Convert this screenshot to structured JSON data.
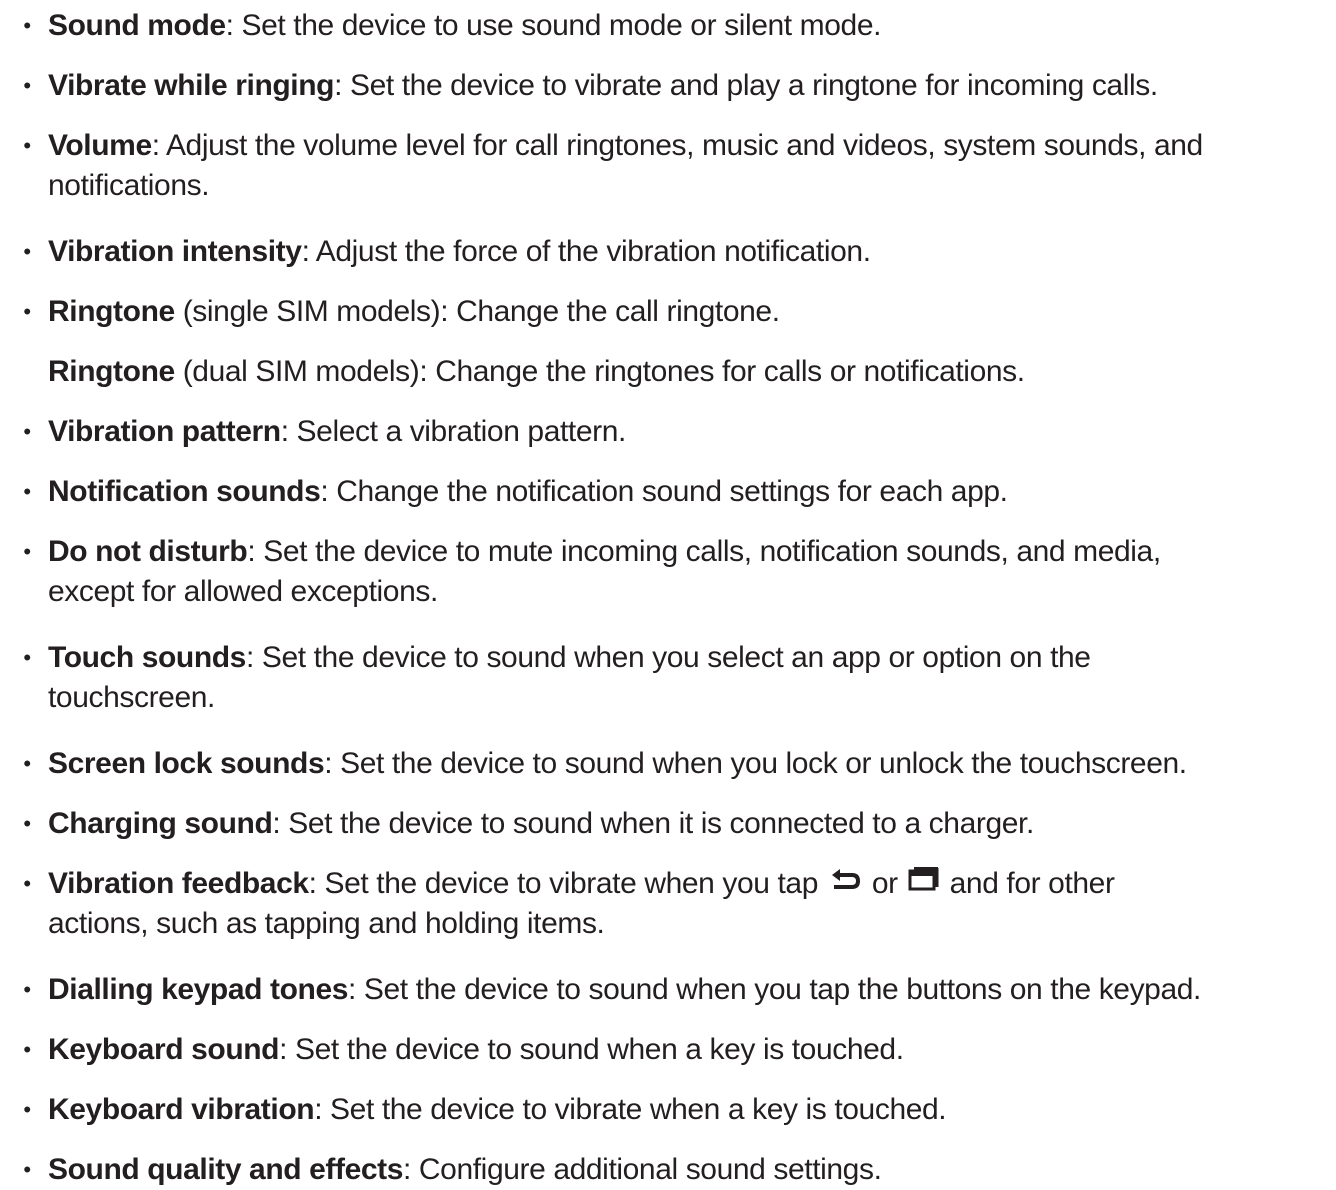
{
  "items": [
    {
      "term": "Sound mode",
      "desc": ": Set the device to use sound mode or silent mode."
    },
    {
      "term": "Vibrate while ringing",
      "desc": ": Set the device to vibrate and play a ringtone for incoming calls."
    },
    {
      "term": "Volume",
      "desc": ": Adjust the volume level for call ringtones, music and videos, system sounds, and",
      "cont": "notifications."
    },
    {
      "term": "Vibration intensity",
      "desc": ": Adjust the force of the vibration notification."
    },
    {
      "term": "Ringtone",
      "desc": " (single SIM models): Change the call ringtone.",
      "term2": "Ringtone",
      "desc2": " (dual SIM models): Change the ringtones for calls or notifications."
    },
    {
      "term": "Vibration pattern",
      "desc": ": Select a vibration pattern."
    },
    {
      "term": "Notification sounds",
      "desc": ": Change the notification sound settings for each app."
    },
    {
      "term": "Do not disturb",
      "desc": ": Set the device to mute incoming calls, notification sounds, and media,",
      "cont": "except for allowed exceptions."
    },
    {
      "term": "Touch sounds",
      "desc": ": Set the device to sound when you select an app or option on the",
      "cont": "touchscreen."
    },
    {
      "term": "Screen lock sounds",
      "desc": ": Set the device to sound when you lock or unlock the touchscreen."
    },
    {
      "term": "Charging sound",
      "desc": ": Set the device to sound when it is connected to a charger."
    },
    {
      "term": "Vibration feedback",
      "desc_a": ": Set the device to vibrate when you tap ",
      "desc_or": " or ",
      "desc_b": " and for other",
      "cont": "actions, such as tapping and holding items.",
      "icon_a": "back-icon",
      "icon_b": "recent-apps-icon"
    },
    {
      "term": "Dialling keypad tones",
      "desc": ": Set the device to sound when you tap the buttons on the keypad."
    },
    {
      "term": "Keyboard sound",
      "desc": ": Set the device to sound when a key is touched."
    },
    {
      "term": "Keyboard vibration",
      "desc": ": Set the device to vibrate when a key is touched."
    },
    {
      "term": "Sound quality and effects",
      "desc": ": Configure additional sound settings."
    }
  ],
  "bullet": "•"
}
